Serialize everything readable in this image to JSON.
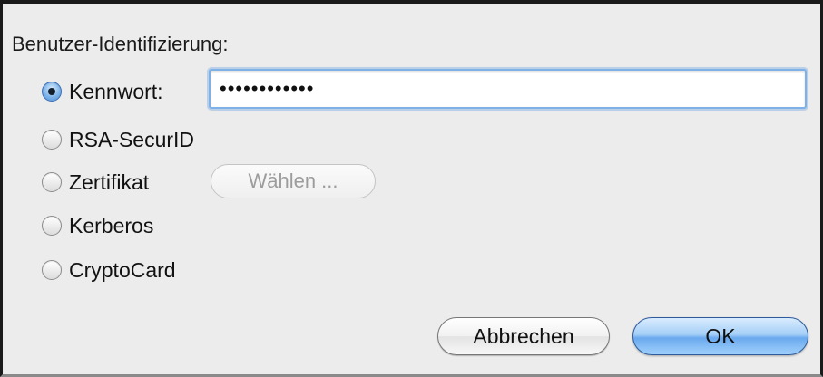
{
  "group": {
    "title": "Benutzer-Identifizierung:"
  },
  "options": [
    {
      "label": "Kennwort:",
      "selected": true
    },
    {
      "label": "RSA-SecurID",
      "selected": false
    },
    {
      "label": "Zertifikat",
      "selected": false
    },
    {
      "label": "Kerberos",
      "selected": false
    },
    {
      "label": "CryptoCard",
      "selected": false
    }
  ],
  "password_field": {
    "value": "••••••••••••"
  },
  "certificate": {
    "choose_label": "Wählen ..."
  },
  "actions": {
    "cancel_label": "Abbrechen",
    "ok_label": "OK"
  },
  "colors": {
    "dialog_background": "#ececec",
    "focus_ring": "#7fb0e6",
    "default_button": "#6aa9ee"
  }
}
